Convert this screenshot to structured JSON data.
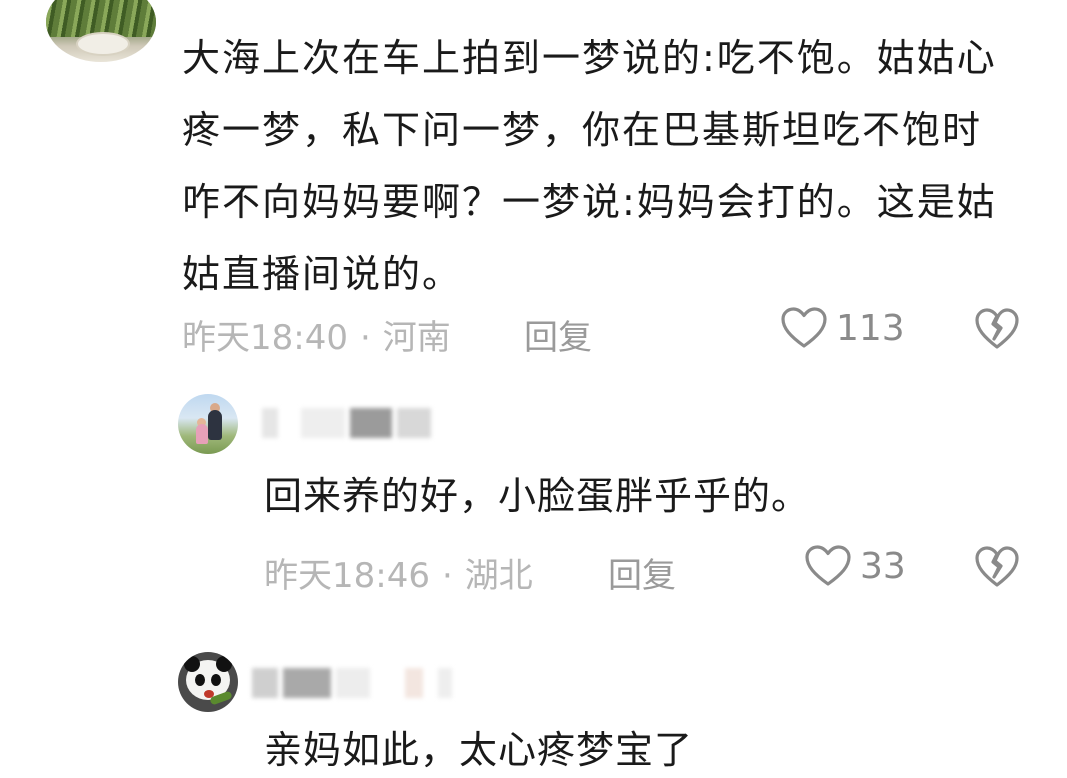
{
  "comment": {
    "text": "大海上次在车上拍到一梦说的:吃不饱。姑姑心疼一梦，私下问一梦，你在巴基斯坦吃不饱时咋不向妈妈要啊？一梦说:妈妈会打的。这是姑姑直播间说的。",
    "time": "昨天18:40",
    "separator": "·",
    "location": "河南",
    "reply_label": "回复",
    "like_count": "113",
    "like_icon": "heart-outline-icon",
    "dislike_icon": "broken-heart-icon"
  },
  "replies": [
    {
      "text": "回来养的好，小脸蛋胖乎乎的。",
      "time": "昨天18:46",
      "separator": "·",
      "location": "湖北",
      "reply_label": "回复",
      "like_count": "33"
    },
    {
      "text": "亲妈如此，太心疼梦宝了"
    }
  ],
  "colors": {
    "text": "#1a1a1a",
    "meta": "#b6b6b6",
    "icon": "#8a8a8a"
  }
}
